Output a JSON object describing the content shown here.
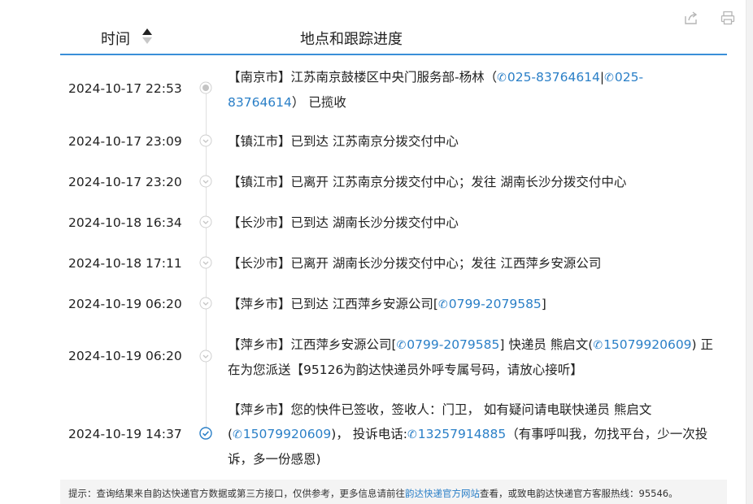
{
  "header": {
    "time_label": "时间",
    "location_label": "地点和跟踪进度"
  },
  "toolbar": {
    "share_icon": "share-icon",
    "print_icon": "printer-icon"
  },
  "colors": {
    "accent": "#3a8fd8",
    "link": "#2a7fc7",
    "done": "#2a7fc7",
    "node": "#c9c9c9"
  },
  "events": [
    {
      "time": "2024-10-17 22:53",
      "status": "start",
      "line1_pre": "【南京市】江苏南京鼓楼区中央门服务部-杨林（",
      "phone1": "025-83764614",
      "sep": "|",
      "phone2": "025-",
      "line2_phone2_rest": "83764614",
      "line2_post": "） 已揽收"
    },
    {
      "time": "2024-10-17 23:09",
      "status": "pending",
      "text": "【镇江市】已到达 江苏南京分拨交付中心"
    },
    {
      "time": "2024-10-17 23:20",
      "status": "pending",
      "text": "【镇江市】已离开 江苏南京分拨交付中心；发往 湖南长沙分拨交付中心"
    },
    {
      "time": "2024-10-18 16:34",
      "status": "pending",
      "text": "【长沙市】已到达 湖南长沙分拨交付中心"
    },
    {
      "time": "2024-10-18 17:11",
      "status": "pending",
      "text": "【长沙市】已离开 湖南长沙分拨交付中心；发往 江西萍乡安源公司"
    },
    {
      "time": "2024-10-19 06:20",
      "status": "pending",
      "pre": "【萍乡市】已到达 江西萍乡安源公司[",
      "phone": "0799-2079585",
      "post": "]"
    },
    {
      "time": "2024-10-19 06:20",
      "status": "pending",
      "line1_pre": "【萍乡市】江西萍乡安源公司[",
      "phone1": "0799-2079585",
      "line1_mid": "] 快递员 熊启文(",
      "phone2": "15079920609",
      "line1_post": ") 正",
      "line2": "在为您派送【95126为韵达快递员外呼专属号码，请放心接听】"
    },
    {
      "time": "2024-10-19 14:37",
      "status": "done",
      "line1": "【萍乡市】您的快件已签收，签收人：门卫， 如有疑问请电联快递员 熊启文",
      "line2_pre": "(",
      "phone1": "15079920609",
      "line2_mid": ")， 投诉电话:",
      "phone2": "13257914885",
      "line2_post": "（有事呼叫我，勿找平台，少一次投",
      "line3": "诉，多一份感恩)"
    }
  ],
  "tip": {
    "pre": "提示：查询结果来自韵达快递官方数据或第三方接口，仅供参考，更多信息请前往",
    "link": "韵达快递官方网站",
    "post": "查看，或致电韵达快递官方客服热线：95546。"
  }
}
